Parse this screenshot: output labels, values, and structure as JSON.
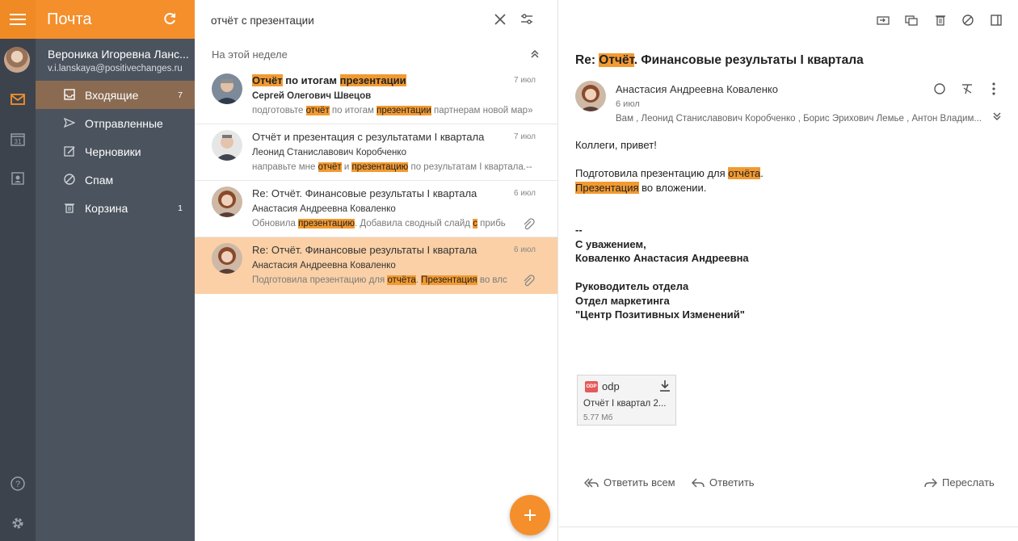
{
  "app": {
    "title": "Почта"
  },
  "account": {
    "name": "Вероника Игоревна Ланс...",
    "email": "v.i.lanskaya@positivechanges.ru"
  },
  "folders": [
    {
      "label": "Входящие",
      "count": "7",
      "icon": "inbox-icon",
      "active": true
    },
    {
      "label": "Отправленные",
      "count": "",
      "icon": "send-icon"
    },
    {
      "label": "Черновики",
      "count": "",
      "icon": "draft-icon"
    },
    {
      "label": "Спам",
      "count": "",
      "icon": "spam-icon"
    },
    {
      "label": "Корзина",
      "count": "1",
      "icon": "trash-icon"
    }
  ],
  "rail": {
    "calendar_day": "31"
  },
  "search": {
    "query": "отчёт с презентации"
  },
  "list": {
    "group_label": "На этой неделе",
    "messages": [
      {
        "subject_parts": [
          {
            "t": "Отчёт",
            "h": true
          },
          {
            "t": " по итогам ",
            "h": false
          },
          {
            "t": "презентации",
            "h": true
          }
        ],
        "sender": "Сергей Олегович Швецов",
        "date": "7 июл",
        "unread": true,
        "preview_parts": [
          {
            "t": "подготовьте ",
            "h": false
          },
          {
            "t": "отчёт",
            "h": true
          },
          {
            "t": " по итогам ",
            "h": false
          },
          {
            "t": "презентации",
            "h": true
          },
          {
            "t": " партнерам новой мар»",
            "h": false
          }
        ],
        "attachment": false
      },
      {
        "subject_parts": [
          {
            "t": "Отчёт и презентация с результатами I квартала",
            "h": false
          }
        ],
        "sender": "Леонид Станиславович Коробченко",
        "date": "7 июл",
        "unread": false,
        "preview_parts": [
          {
            "t": "направьте мне ",
            "h": false
          },
          {
            "t": "отчёт",
            "h": true
          },
          {
            "t": " и ",
            "h": false
          },
          {
            "t": "презентацию",
            "h": true
          },
          {
            "t": " по результатам I квартала.--",
            "h": false
          }
        ],
        "attachment": false
      },
      {
        "subject_parts": [
          {
            "t": "Re: Отчёт. Финансовые результаты I квартала",
            "h": false
          }
        ],
        "sender": "Анастасия Андреевна Коваленко",
        "date": "6 июл",
        "unread": false,
        "preview_parts": [
          {
            "t": "Обновила ",
            "h": false
          },
          {
            "t": "презентацию",
            "h": true
          },
          {
            "t": ". Добавила сводный слайд ",
            "h": false
          },
          {
            "t": "с",
            "h": true
          },
          {
            "t": " прибь",
            "h": false
          }
        ],
        "attachment": true
      },
      {
        "subject_parts": [
          {
            "t": "Re: Отчёт. Финансовые результаты I квартала",
            "h": false
          }
        ],
        "sender": "Анастасия Андреевна Коваленко",
        "date": "6 июл",
        "unread": false,
        "selected": true,
        "preview_parts": [
          {
            "t": "Подготовила презентацию для ",
            "h": false
          },
          {
            "t": "отчёта",
            "h": true
          },
          {
            "t": ". ",
            "h": false
          },
          {
            "t": "Презентация",
            "h": true
          },
          {
            "t": " во влс",
            "h": false
          }
        ],
        "attachment": true
      }
    ]
  },
  "reader": {
    "subject_prefix": "Re: ",
    "subject_hl": "Отчёт",
    "subject_rest": ". Финансовые результаты I квартала",
    "from": "Анастасия Андреевна Коваленко",
    "date": "6 июл",
    "to": "Вам , Леонид Станиславович Коробченко , Борис Эрихович Лемье , Антон Владим...",
    "greeting": "Коллеги, привет!",
    "line1_text": "Подготовила презентацию для ",
    "line1_hl": "отчёта",
    "line1_end": ".",
    "line2_hl": "Презентация",
    "line2_rest": " во вложении.",
    "sig_sep": "--",
    "sig_regards": "С уважением,",
    "sig_name": "Коваленко Анастасия Андреевна",
    "sig_title": "Руководитель отдела",
    "sig_dept": "Отдел маркетинга",
    "sig_company": "\"Центр Позитивных Изменений\"",
    "attachment": {
      "badge": "ODP",
      "ext": "odp",
      "name": "Отчёт I квартал 2...",
      "size": "5.77 Мб"
    },
    "actions": {
      "reply_all": "Ответить всем",
      "reply": "Ответить",
      "forward": "Переслать"
    }
  },
  "colors": {
    "accent": "#f48f2c",
    "highlight": "#f29a32",
    "rail": "#3c434c",
    "sidebar": "#4b535e",
    "selected_row": "#fbd0a6"
  }
}
